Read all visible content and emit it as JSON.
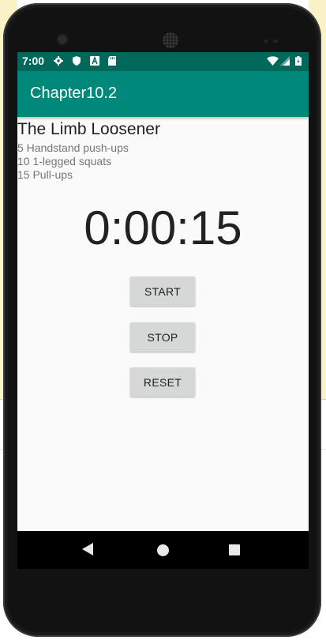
{
  "statusbar": {
    "time": "7:00"
  },
  "appbar": {
    "title": "Chapter10.2"
  },
  "workout": {
    "title": "The Limb Loosener",
    "exercises": [
      "5 Handstand push-ups",
      "10 1-legged squats",
      "15 Pull-ups"
    ]
  },
  "stopwatch": {
    "time": "0:00:15",
    "start_label": "START",
    "stop_label": "STOP",
    "reset_label": "RESET"
  },
  "colors": {
    "status_bar": "#00695c",
    "app_bar": "#00897b",
    "button": "#d6d7d7"
  },
  "icons": [
    "gear-icon",
    "shield-icon",
    "a-icon",
    "sd-card-icon",
    "wifi-icon",
    "signal-icon",
    "battery-icon",
    "back-icon",
    "home-icon",
    "recents-icon"
  ]
}
